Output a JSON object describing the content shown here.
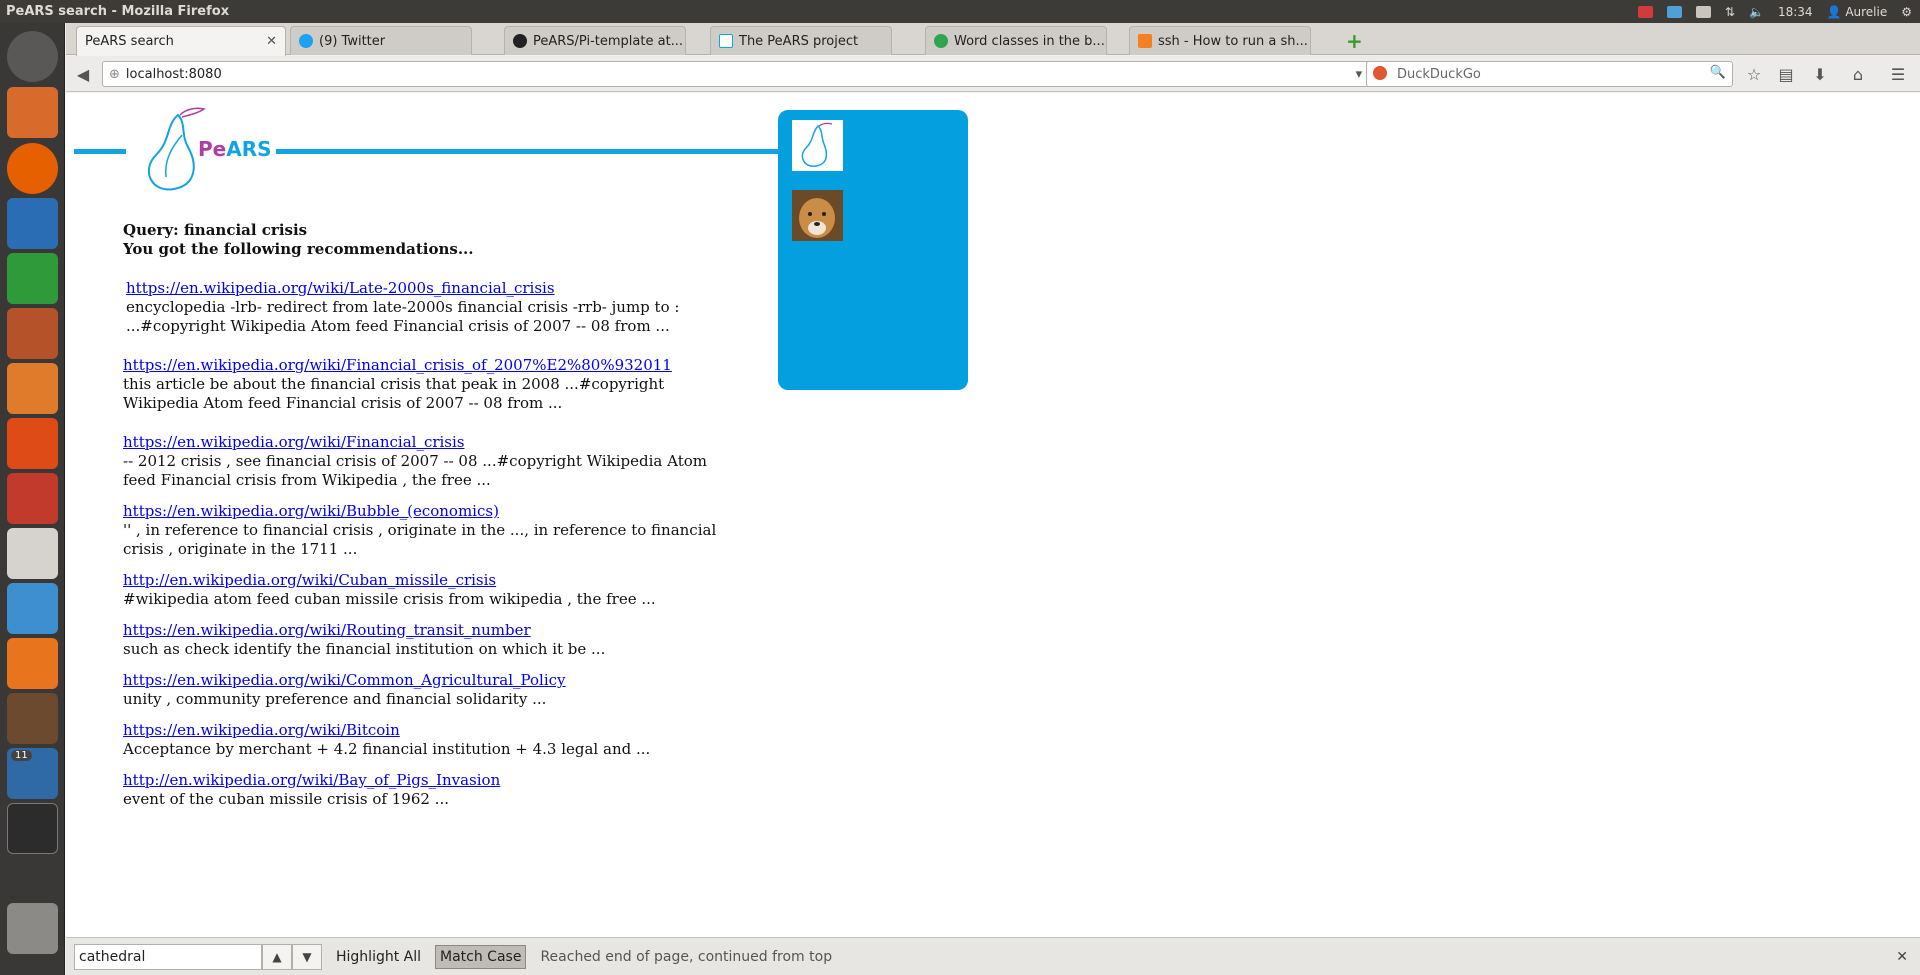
{
  "window_title": "PeARS search - Mozilla Firefox",
  "indicators": {
    "time": "18:34",
    "user": "Aurelie"
  },
  "tabs": [
    {
      "label": "PeARS search",
      "active": true
    },
    {
      "label": "(9) Twitter"
    },
    {
      "label": "PeARS/Pi-template at..."
    },
    {
      "label": "The PeARS project"
    },
    {
      "label": "Word classes in the b..."
    },
    {
      "label": "ssh - How to run a sh..."
    }
  ],
  "nav": {
    "url": "localhost:8080",
    "search_placeholder": "DuckDuckGo"
  },
  "logo": {
    "text": "PeARS",
    "colors": {
      "line": "#12a3e3",
      "pe": "#b03da3",
      "ars": "#12a3e3"
    }
  },
  "results": {
    "query_line": "Query: financial crisis",
    "intro": "You got the following recommendations...",
    "items": [
      {
        "url": "https://en.wikipedia.org/wiki/Late-2000s_financial_crisis",
        "snippet": "encyclopedia -lrb- redirect from late-2000s financial crisis -rrb- jump to : ...#copyright Wikipedia Atom feed Financial crisis of 2007 -- 08 from ..."
      },
      {
        "url": "https://en.wikipedia.org/wiki/Financial_crisis_of_2007%E2%80%932011",
        "snippet": "this article be about the financial crisis that peak in 2008 ...#copyright Wikipedia Atom feed Financial crisis of 2007 -- 08 from ..."
      },
      {
        "url": "https://en.wikipedia.org/wiki/Financial_crisis",
        "snippet": "-- 2012 crisis , see financial crisis of 2007 -- 08 ...#copyright Wikipedia Atom feed Financial crisis from Wikipedia , the free ..."
      },
      {
        "url": "https://en.wikipedia.org/wiki/Bubble_(economics)",
        "snippet": "'' , in reference to financial crisis , originate in the ..., in reference to financial crisis , originate in the 1711 ..."
      },
      {
        "url": "http://en.wikipedia.org/wiki/Cuban_missile_crisis",
        "snippet": "#wikipedia atom feed cuban missile crisis from wikipedia , the free ..."
      },
      {
        "url": "https://en.wikipedia.org/wiki/Routing_transit_number",
        "snippet": "such as check identify the financial institution on which it be ..."
      },
      {
        "url": "https://en.wikipedia.org/wiki/Common_Agricultural_Policy",
        "snippet": "unity , community preference and financial solidarity ..."
      },
      {
        "url": "https://en.wikipedia.org/wiki/Bitcoin",
        "snippet": "Acceptance by merchant + 4.2 financial institution + 4.3 legal and ..."
      },
      {
        "url": "http://en.wikipedia.org/wiki/Bay_of_Pigs_Invasion",
        "snippet": "event of the cuban missile crisis of 1962 ..."
      }
    ]
  },
  "findbar": {
    "value": "cathedral",
    "highlight_all": "Highlight All",
    "match_case": "Match Case",
    "status": "Reached end of page, continued from top"
  },
  "launcher_badge": "11",
  "colors": {
    "panel": "#049fdf",
    "link": "#0000ee"
  }
}
